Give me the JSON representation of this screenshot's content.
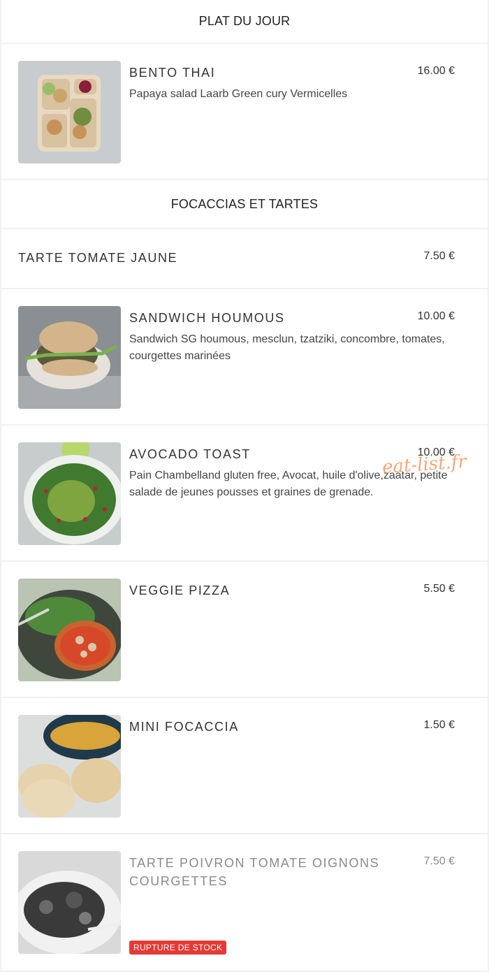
{
  "sections": [
    {
      "title": "PLAT DU JOUR"
    },
    {
      "title": "FOCACCIAS ET TARTES"
    }
  ],
  "items": [
    {
      "name": "BENTO THAI",
      "price": "16.00 €",
      "desc": "Papaya salad Laarb Green cury Vermicelles",
      "image": "bento-photo"
    },
    {
      "name": "TARTE TOMATE JAUNE",
      "price": "7.50 €",
      "desc": "",
      "image": ""
    },
    {
      "name": "SANDWICH HOUMOUS",
      "price": "10.00 €",
      "desc": "Sandwich SG houmous, mesclun, tzatziki, concombre, tomates, courgettes marinées",
      "image": "sandwich-photo"
    },
    {
      "name": "AVOCADO TOAST",
      "price": "10.00 €",
      "desc": "Pain Chambelland gluten free, Avocat, huile d'olive,zaatar, petite salade de jeunes pousses et graines de grenade.",
      "image": "avocado-toast-photo"
    },
    {
      "name": "VEGGIE PIZZA",
      "price": "5.50 €",
      "desc": "",
      "image": "pizza-photo"
    },
    {
      "name": "MINI FOCACCIA",
      "price": "1.50 €",
      "desc": "",
      "image": "focaccia-photo"
    },
    {
      "name": "TARTE POIVRON TOMATE OIGNONS COURGETTES",
      "price": "7.50 €",
      "desc": "",
      "image": "tarte-photo",
      "badge": "RUPTURE DE STOCK"
    }
  ],
  "watermark": "eat-list.fr",
  "colors": {
    "badge": "#e53935",
    "watermark": "#f39a64"
  }
}
